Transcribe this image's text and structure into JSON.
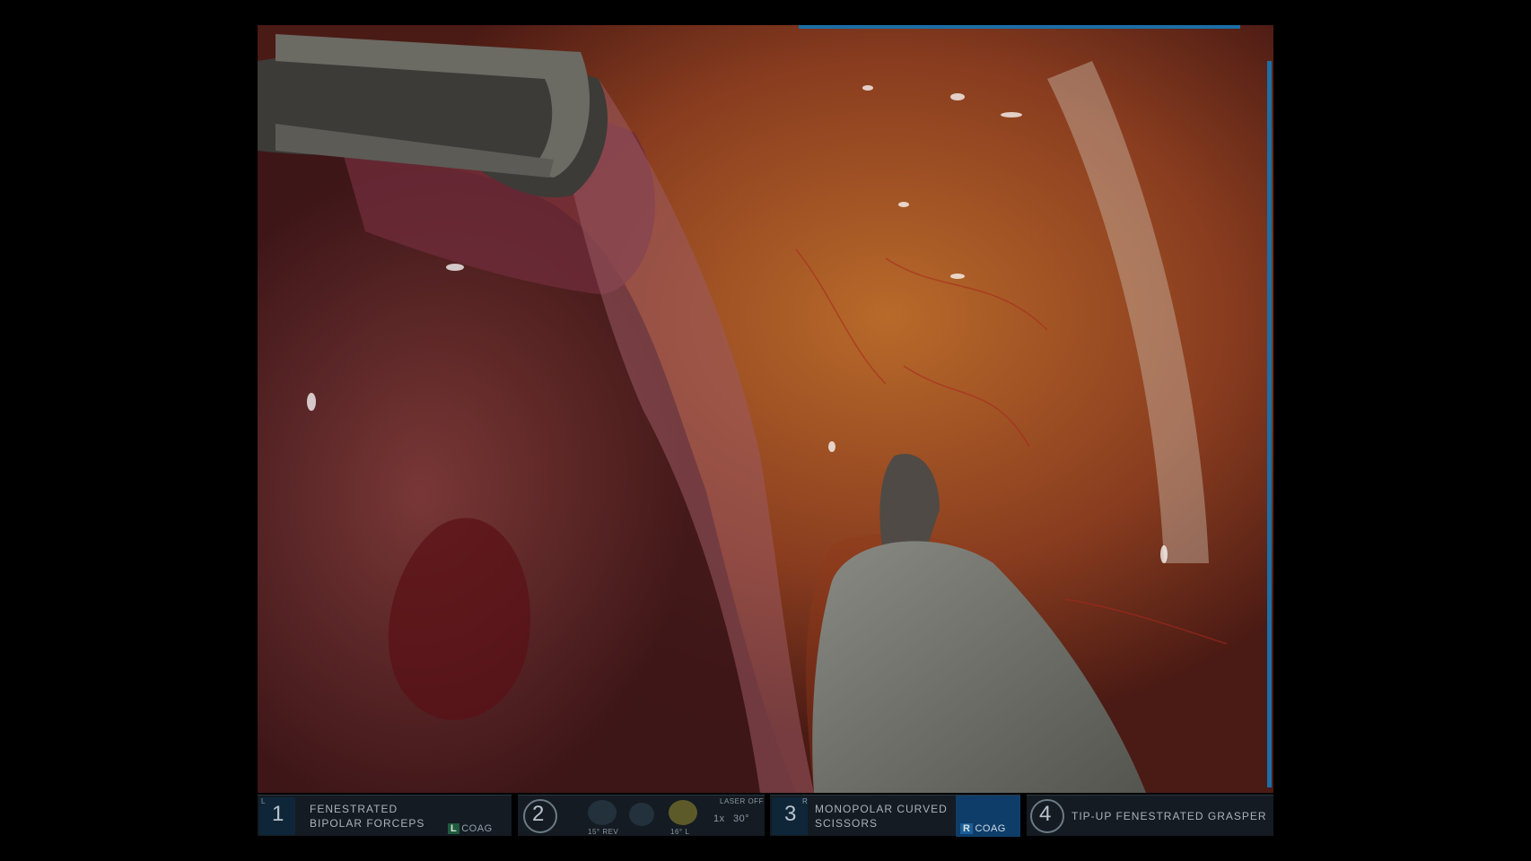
{
  "arms": [
    {
      "number": "1",
      "side": "L",
      "label_line1": "FENESTRATED",
      "label_line2": "BIPOLAR FORCEPS",
      "energy_side": "L",
      "energy_mode": "COAG"
    },
    {
      "number": "2"
    },
    {
      "number": "3",
      "side": "R",
      "label_line1": "MONOPOLAR CURVED",
      "label_line2": "SCISSORS",
      "energy_side": "R",
      "energy_mode": "COAG"
    },
    {
      "number": "4",
      "label_line1": "TIP-UP FENESTRATED GRASPER"
    }
  ],
  "camera": {
    "laser_status": "LASER OFF",
    "left_angle": "15° REV",
    "right_angle": "16° L",
    "zoom": "1x",
    "scope_angle": "30°"
  },
  "colors": {
    "hud_accent": "#1d6fa5",
    "coag_left": "#1f5a3f",
    "coag_right": "#1c5d97"
  }
}
